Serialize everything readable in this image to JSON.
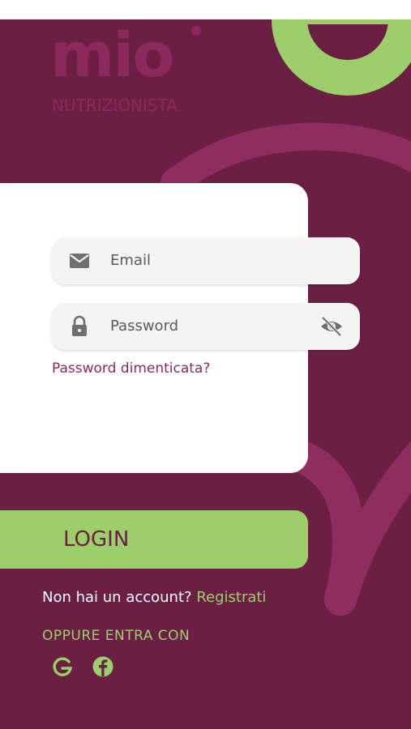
{
  "brand": {
    "logo_word": "mio",
    "logo_sub": "NUTRIZIONISTA"
  },
  "form": {
    "email_placeholder": "Email",
    "password_placeholder": "Password",
    "forgot_password": "Password dimenticata?"
  },
  "actions": {
    "login_label": "LOGIN",
    "no_account_text": "Non hai un account?",
    "register_link": "Registrati",
    "alt_login_label": "OPPURE ENTRA CON"
  },
  "icons": {
    "email": "mail-icon",
    "password": "lock-icon",
    "toggle_visibility": "eye-off-icon",
    "google": "google-icon",
    "facebook": "facebook-icon"
  },
  "colors": {
    "background": "#6b2043",
    "accent_green": "#9ccf6b",
    "brand_magenta": "#8c2a5b",
    "card": "#ffffff"
  }
}
